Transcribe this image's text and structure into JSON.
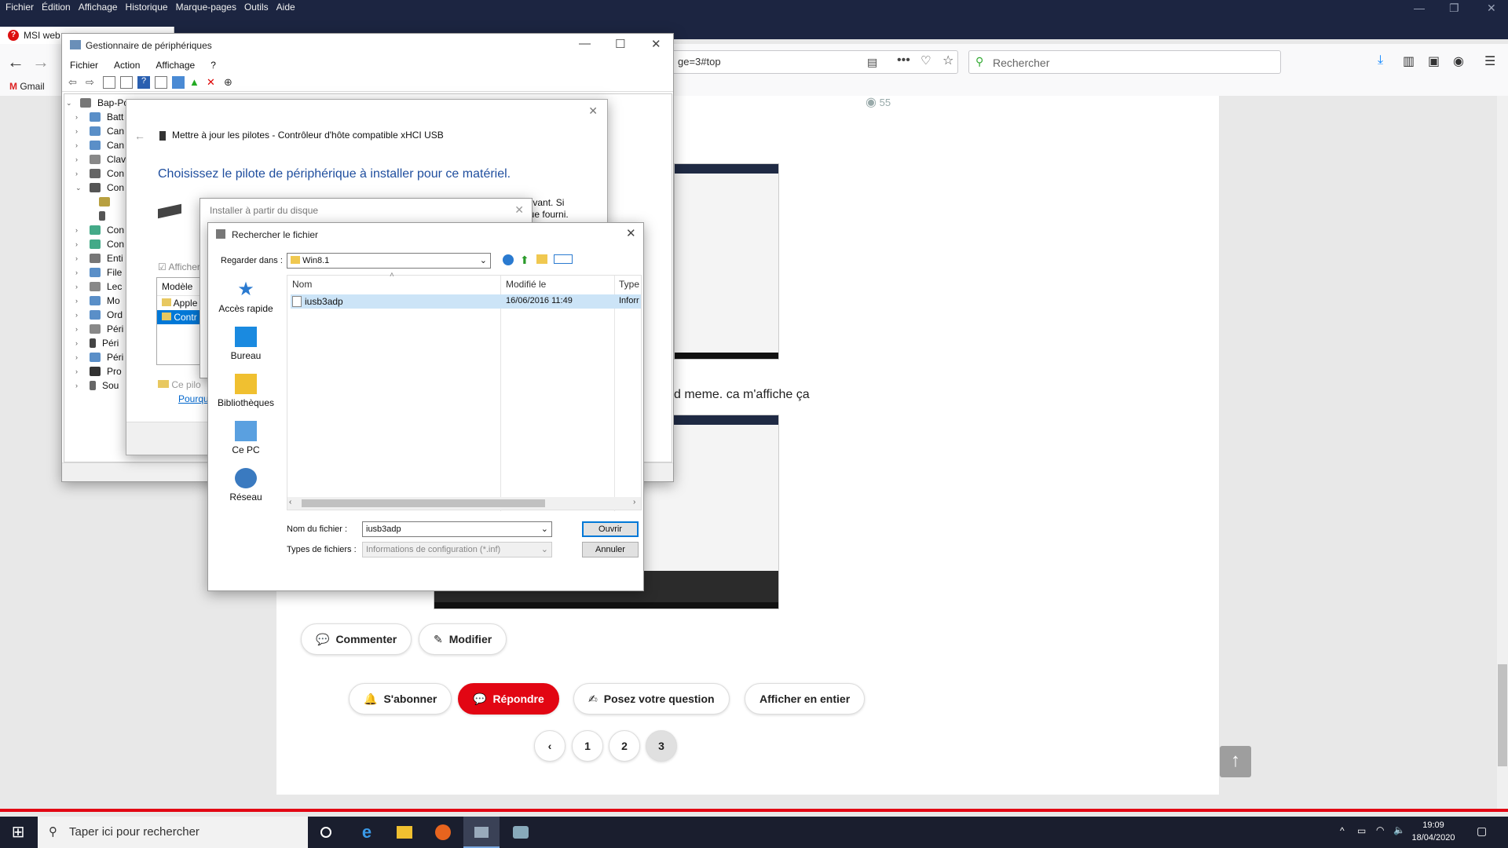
{
  "firefox": {
    "menu": [
      "Fichier",
      "Édition",
      "Affichage",
      "Historique",
      "Marque-pages",
      "Outils",
      "Aide"
    ],
    "tab_title": "MSI web",
    "url_fragment": "ge=3#top",
    "search_placeholder": "Rechercher",
    "bookmark_gmail": "Gmail"
  },
  "page": {
    "views_count": "55",
    "body_text": "d meme. ca m'affiche ça",
    "buttons": {
      "comment": "Commenter",
      "edit": "Modifier",
      "subscribe": "S'abonner",
      "reply": "Répondre",
      "ask": "Posez votre question",
      "show_full": "Afficher en entier"
    },
    "pagination": [
      "1",
      "2",
      "3"
    ],
    "current_page": "3",
    "colors": {
      "accent_red": "#e20613",
      "navy": "#1c2541"
    }
  },
  "device_manager": {
    "title": "Gestionnaire de périphériques",
    "menu": [
      "Fichier",
      "Action",
      "Affichage",
      "?"
    ],
    "tree_root": "Bap-Pc",
    "tree_items": [
      "Batt",
      "Can",
      "Can",
      "Clav",
      "Con",
      "Con",
      "Con",
      "Con",
      "Enti",
      "File",
      "Lec",
      "Mo",
      "Ord",
      "Péri",
      "Péri",
      "Péri",
      "Pro",
      "Sou"
    ]
  },
  "update_wizard": {
    "title": "Mettre à jour les pilotes - Contrôleur d'hôte compatible xHCI USB",
    "heading": "Choisissez le pilote de périphérique à installer pour ce matériel.",
    "partial_text_1": "Suivant. Si",
    "partial_text_2": "sque fourni.",
    "checkbox_label": "Afficher",
    "list_header": "Modèle",
    "list_items": [
      "Apple",
      "Contr"
    ],
    "footer_text": "Ce pilo",
    "footer_link": "Pourqu"
  },
  "install_from_disk": {
    "title": "Installer à partir du disque"
  },
  "browse_dialog": {
    "title": "Rechercher le fichier",
    "look_in_label": "Regarder dans :",
    "look_in_value": "Win8.1",
    "places": [
      "Accès rapide",
      "Bureau",
      "Bibliothèques",
      "Ce PC",
      "Réseau"
    ],
    "columns": {
      "name": "Nom",
      "modified": "Modifié le",
      "type": "Type"
    },
    "files": [
      {
        "name": "iusb3adp",
        "modified": "16/06/2016 11:49",
        "type": "Inforr"
      }
    ],
    "filename_label": "Nom du fichier :",
    "filename_value": "iusb3adp",
    "filetype_label": "Types de fichiers :",
    "filetype_value": "Informations de configuration (*.inf)",
    "open_button": "Ouvrir",
    "cancel_button": "Annuler"
  },
  "taskbar": {
    "search_placeholder": "Taper ici pour rechercher",
    "time": "19:09",
    "date": "18/04/2020"
  }
}
